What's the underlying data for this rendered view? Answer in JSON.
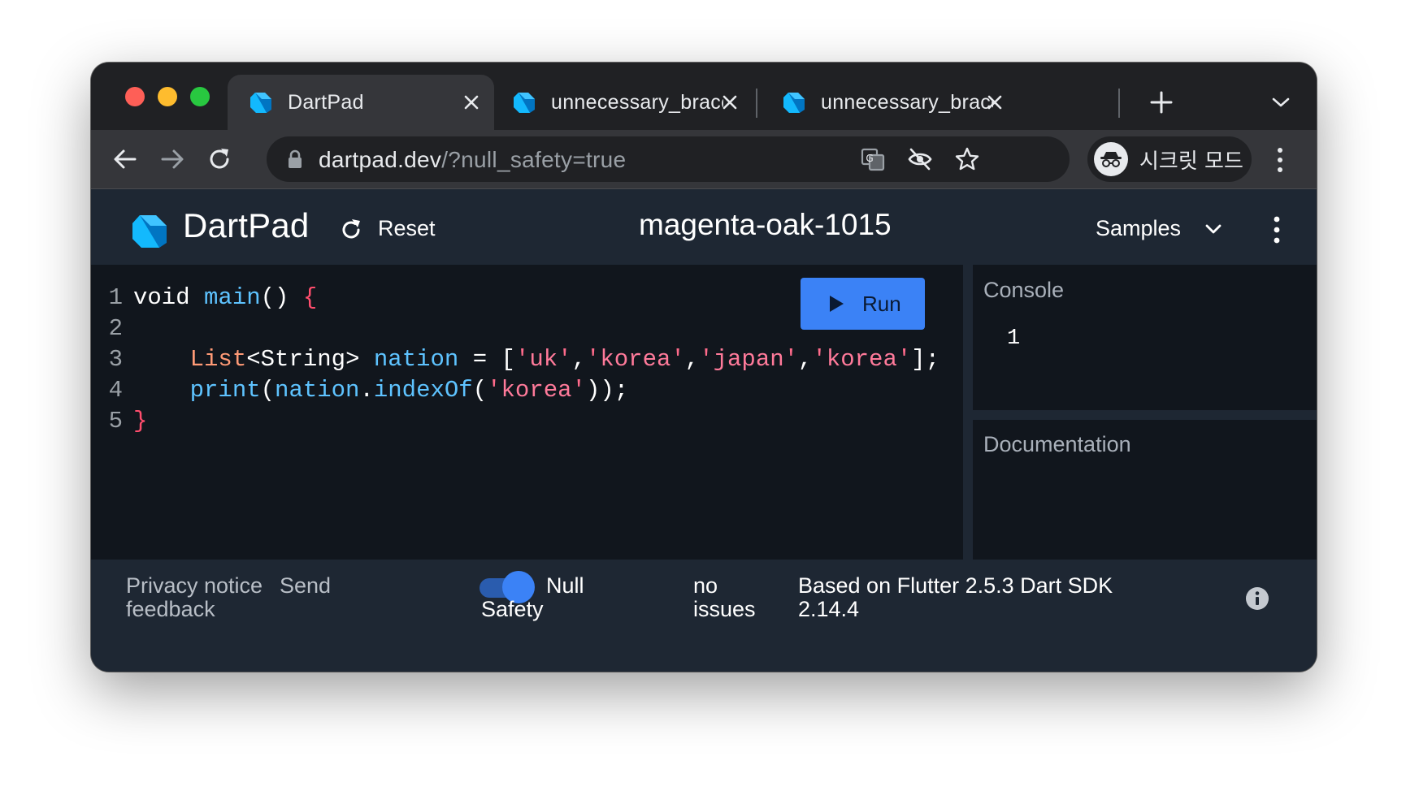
{
  "browser": {
    "tabs": [
      {
        "title": "DartPad",
        "active": true
      },
      {
        "title": "unnecessary_brace_",
        "active": false
      },
      {
        "title": "unnecessary_brace_",
        "active": false
      }
    ],
    "url_host": "dartpad.dev",
    "url_path": "/?null_safety=true",
    "incognito_label": "시크릿 모드"
  },
  "app": {
    "brand": "DartPad",
    "reset_label": "Reset",
    "pad_title": "magenta-oak-1015",
    "samples_label": "Samples",
    "run_label": "Run"
  },
  "editor": {
    "line_numbers": [
      "1",
      "2",
      "3",
      "4",
      "5"
    ],
    "code_lines": [
      "void main() {",
      "",
      "    List<String> nation = ['uk','korea','japan','korea'];",
      "    print(nation.indexOf('korea'));",
      "}"
    ]
  },
  "console": {
    "header": "Console",
    "output": "1"
  },
  "docs": {
    "header": "Documentation"
  },
  "footer": {
    "privacy_line1": "Privacy notice",
    "privacy_line2": "",
    "send_line1": "Send",
    "send_line2": "feedback",
    "privacy_notice": "Privacy notice",
    "null_line1": "Null",
    "null_line2": "Safety",
    "null_safety_enabled": true,
    "issues_line1": "no",
    "issues_line2": "issues",
    "version_line1": "Based on Flutter 2.5.3 Dart SDK",
    "version_line2": "2.14.4"
  },
  "icons": {
    "favicon": "dart-logo-icon",
    "theme_colors": {
      "accent": "#3b82f6",
      "header_bg": "#1e2733",
      "editor_bg": "#11161d"
    }
  }
}
